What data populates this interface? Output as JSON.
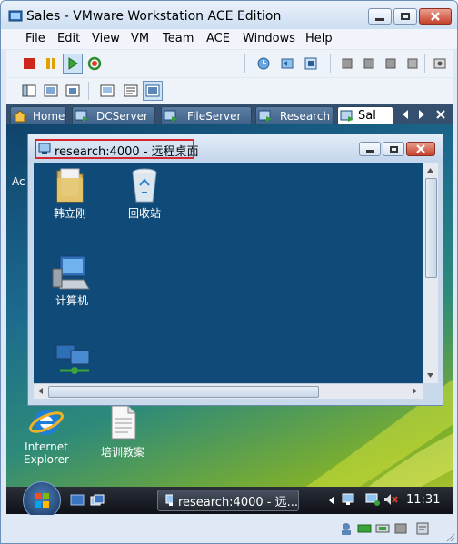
{
  "window": {
    "title": "Sales - VMware Workstation ACE Edition"
  },
  "menu": [
    "File",
    "Edit",
    "View",
    "VM",
    "Team",
    "ACE",
    "Windows",
    "Help"
  ],
  "tabs": [
    "Home",
    "DCServer",
    "FileServer",
    "Research",
    "Sal"
  ],
  "guest": {
    "left_partial_label": "Ac"
  },
  "remote_window": {
    "title": "research:4000 - 远程桌面"
  },
  "remote_desktop_icons": [
    {
      "label": "韩立刚",
      "icon": "folder-icon"
    },
    {
      "label": "回收站",
      "icon": "recycle-bin-icon"
    },
    {
      "label": "计算机",
      "icon": "computer-icon"
    },
    {
      "label": "",
      "icon": "network-icon"
    }
  ],
  "desktop_icons": [
    {
      "label_line1": "Internet",
      "label_line2": "Explorer",
      "icon": "internet-explorer-icon"
    },
    {
      "label": "培训教案",
      "icon": "document-icon"
    }
  ],
  "taskbar": {
    "task_label": "research:4000 - 远...",
    "clock": "11:31"
  },
  "colors": {
    "accent": "#d7262d",
    "remote_desktop_bg": "#0f4a78",
    "tab_bar": "#34506e"
  }
}
